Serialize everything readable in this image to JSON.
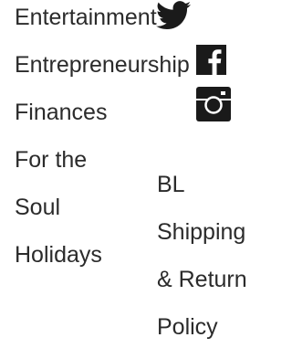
{
  "categories": {
    "items": [
      {
        "label": "Entertainment"
      },
      {
        "label": "Entrepreneurship"
      },
      {
        "label": "Finances"
      },
      {
        "label": "For the"
      },
      {
        "label": "Soul"
      },
      {
        "label": "Holidays"
      }
    ]
  },
  "social": {
    "twitter_icon": "twitter-bird",
    "facebook_icon": "facebook-f",
    "instagram_icon": "instagram-camera",
    "icon_color": "#1a1a1a"
  },
  "policies": {
    "lines": [
      "BL",
      "Shipping",
      "& Return",
      "Policy"
    ]
  },
  "colors": {
    "text": "#2b2b2b",
    "background": "#ffffff"
  }
}
